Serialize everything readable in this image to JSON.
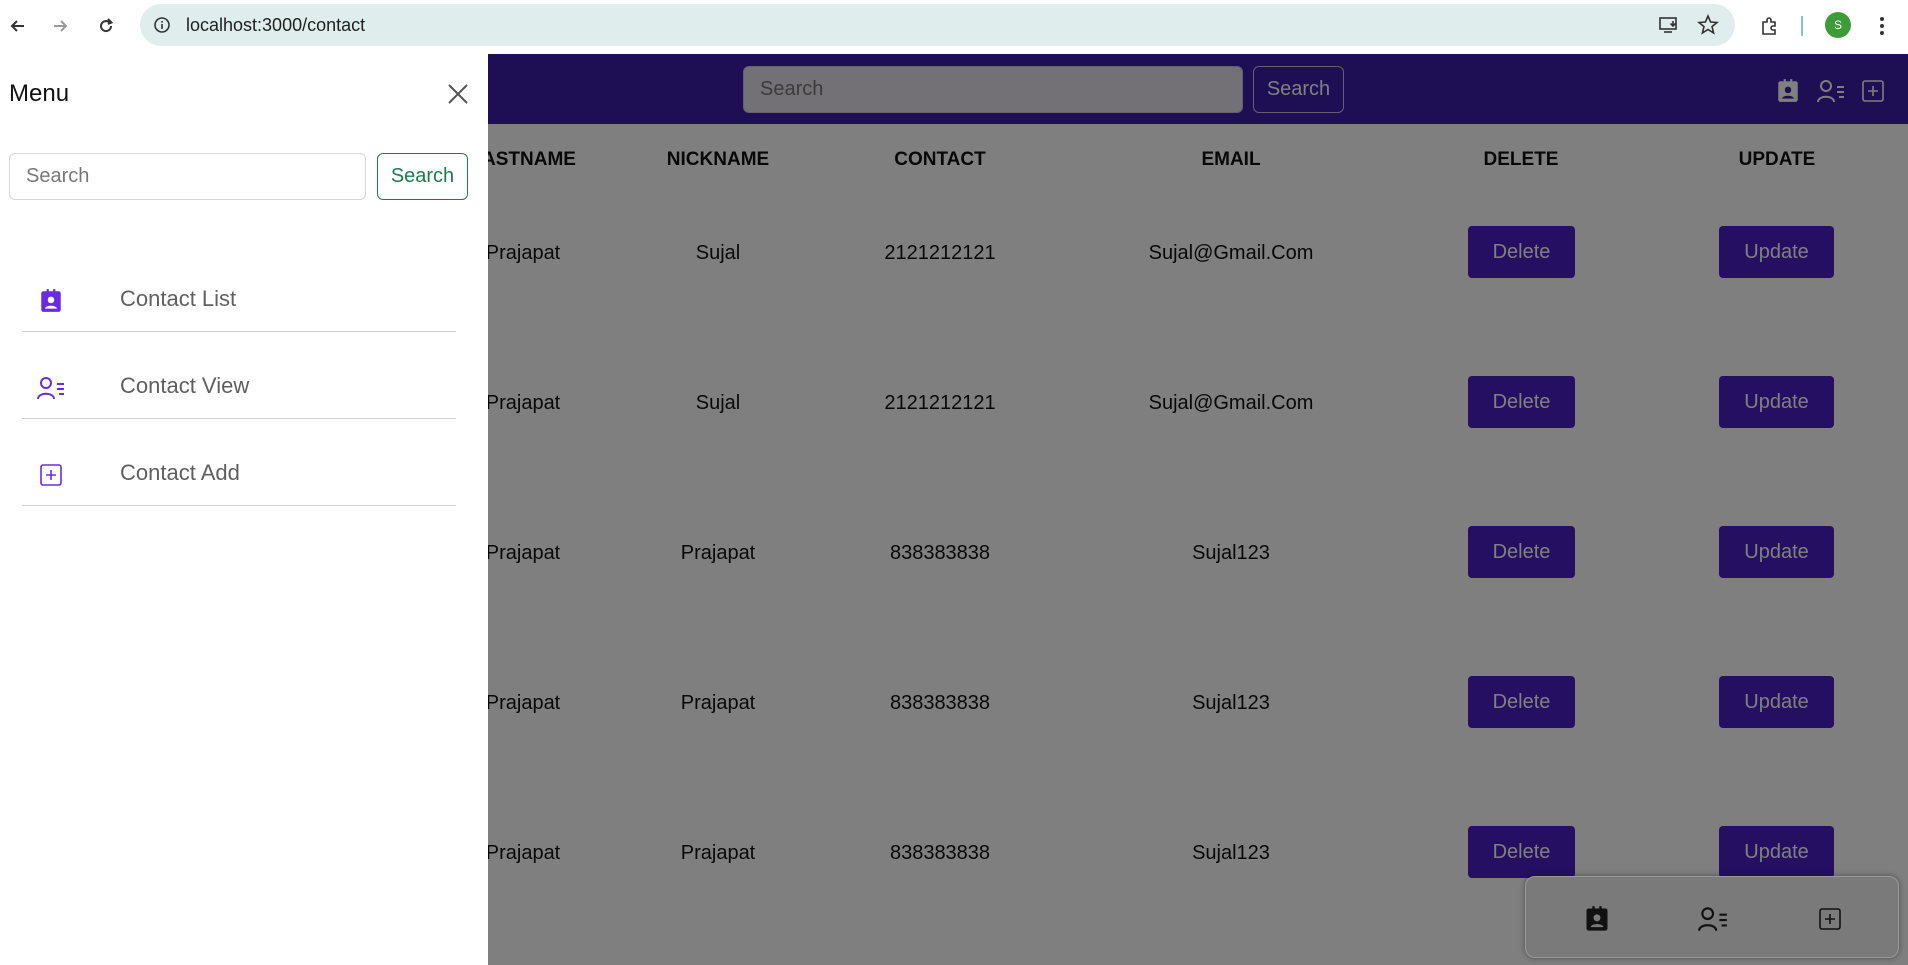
{
  "browser": {
    "url": "localhost:3000/contact",
    "avatar_letter": "S"
  },
  "appbar": {
    "search_placeholder": "Search",
    "search_button": "Search",
    "color": "#3d1ea8"
  },
  "table": {
    "headers": [
      "ASTNAME",
      "NICKNAME",
      "CONTACT",
      "EMAIL",
      "DELETE",
      "UPDATE"
    ],
    "rows": [
      {
        "lastname": "Prajapat",
        "nickname": "Sujal",
        "contact": "2121212121",
        "email": "Sujal@Gmail.Com",
        "delete": "Delete",
        "update": "Update"
      },
      {
        "lastname": "Prajapat",
        "nickname": "Sujal",
        "contact": "2121212121",
        "email": "Sujal@Gmail.Com",
        "delete": "Delete",
        "update": "Update"
      },
      {
        "lastname": "Prajapat",
        "nickname": "Prajapat",
        "contact": "838383838",
        "email": "Sujal123",
        "delete": "Delete",
        "update": "Update"
      },
      {
        "lastname": "Prajapat",
        "nickname": "Prajapat",
        "contact": "838383838",
        "email": "Sujal123",
        "delete": "Delete",
        "update": "Update"
      },
      {
        "lastname": "Prajapat",
        "nickname": "Prajapat",
        "contact": "838383838",
        "email": "Sujal123",
        "delete": "Delete",
        "update": "Update"
      }
    ]
  },
  "drawer": {
    "title": "Menu",
    "search_placeholder": "Search",
    "search_button": "Search",
    "items": [
      {
        "label": "Contact List",
        "icon": "contact-list-icon"
      },
      {
        "label": "Contact View",
        "icon": "contact-view-icon"
      },
      {
        "label": "Contact Add",
        "icon": "contact-add-icon"
      }
    ],
    "accent": "#6a2be0"
  }
}
